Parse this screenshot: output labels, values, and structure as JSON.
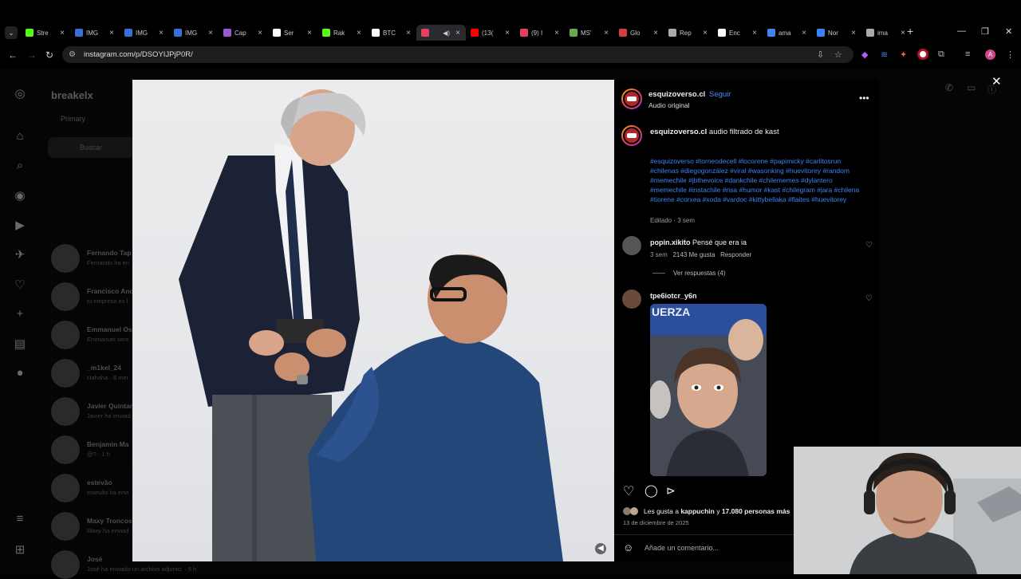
{
  "browser": {
    "tabs": [
      {
        "title": "Stre",
        "color": "#53fc18"
      },
      {
        "title": "IMG",
        "color": "#3b6fd8"
      },
      {
        "title": "IMG",
        "color": "#3b6fd8"
      },
      {
        "title": "IMG",
        "color": "#3b6fd8"
      },
      {
        "title": "Cap",
        "color": "#9b59d0"
      },
      {
        "title": "Ser",
        "color": "#ffffff"
      },
      {
        "title": "Rak",
        "color": "#53fc18"
      },
      {
        "title": "BTC",
        "color": "#ffffff"
      },
      {
        "title": "",
        "color": "#e4405f",
        "active": true
      },
      {
        "title": "(13(",
        "color": "#ff0000"
      },
      {
        "title": "(9) I",
        "color": "#e4405f"
      },
      {
        "title": "MS'",
        "color": "#6aa84f"
      },
      {
        "title": "Glo",
        "color": "#d04040"
      },
      {
        "title": "Rep",
        "color": "#aaaaaa"
      },
      {
        "title": "Enc",
        "color": "#ffffff"
      },
      {
        "title": "ama",
        "color": "#4285f4"
      },
      {
        "title": "Nor",
        "color": "#3b82f6"
      },
      {
        "title": "ima",
        "color": "#aaaaaa"
      }
    ],
    "url": "instagram.com/p/DSOYIJPjP0R/",
    "profile_initial": "A"
  },
  "sidebar": {
    "account": "breakelx",
    "primary_tab": "Primary",
    "search_placeholder": "Buscar",
    "threads": [
      {
        "name": "Fernando Tap",
        "sub": "Fernando ha en"
      },
      {
        "name": "Francisco And",
        "sub": "tu empresa es l"
      },
      {
        "name": "Emmanuel Os",
        "sub": "Emmanuel sent"
      },
      {
        "name": "_m1kel_24",
        "sub": "Hahaha · 8 min"
      },
      {
        "name": "Javier Quintar",
        "sub": "Javier ha enviad"
      },
      {
        "name": "Benjamin Ma",
        "sub": "@? · 1 h"
      },
      {
        "name": "estevão",
        "sub": "estevão ha envi"
      },
      {
        "name": "Maxy Troncos",
        "sub": "Maxy ha enviad"
      },
      {
        "name": "José",
        "sub": "José ha enviado un archivo adjunto. · 5 h"
      }
    ]
  },
  "post": {
    "author": "esquizoverso.cl",
    "follow": "Seguir",
    "audio": "Audio original",
    "caption": "audio filtrado de kast",
    "hashtags": "#esquizoverso #torneodecell #locorene #papimicky #carlitosrun #chilenas #diegogonzález #viral #wasonking #huevitorey #random #memechile #jbthevoice #dankchile #chilememes #dylantero #memechile #instachile #risa #humor #kast #chilegram #jara #chilena #tiorene #corxea #xoda #vardoc #kittybellaka #flaites #huevitorey",
    "edited": "Editado · 3 sem",
    "comments": [
      {
        "user": "popin.xikito",
        "text": "Pensé que era ia",
        "age": "3 sem",
        "likes": "2143 Me gusta",
        "reply": "Responder",
        "view_replies": "Ver respuestas (4)"
      },
      {
        "user": "tpe6iotcr_y6n",
        "gif_text": "UERZA"
      }
    ],
    "likes_prefix": "Les gusta a ",
    "likes_user": "kappuchin",
    "likes_suffix": " y ",
    "likes_count": "17.080 personas más",
    "date": "13 de diciembre de 2025",
    "comment_placeholder": "Añade un comentario..."
  }
}
